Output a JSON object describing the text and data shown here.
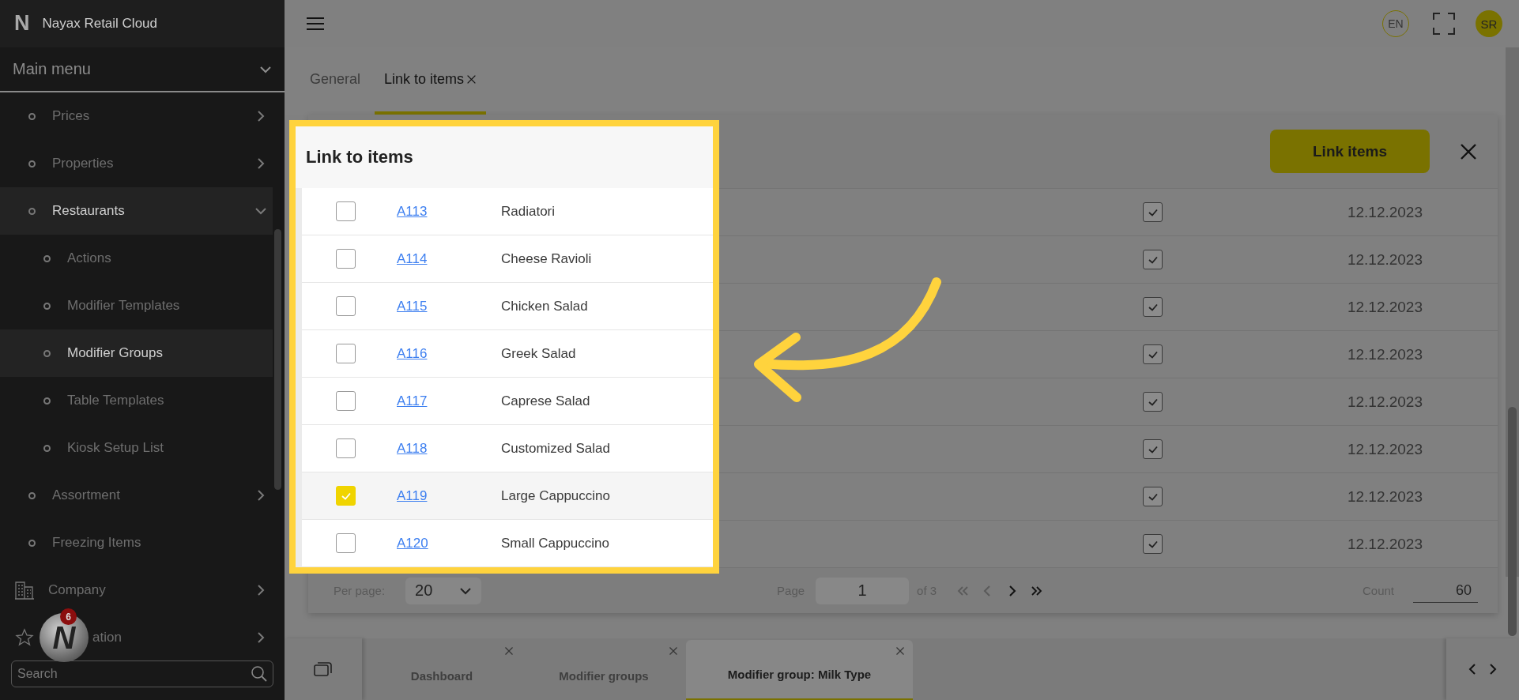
{
  "sidebar": {
    "brand": {
      "logo": "N",
      "name": "Nayax Retail Cloud"
    },
    "menu_title": "Main menu",
    "items": [
      {
        "label": "Prices",
        "kind": "bullet",
        "expanded": false,
        "selected": false
      },
      {
        "label": "Properties",
        "kind": "bullet",
        "expanded": false,
        "selected": false
      },
      {
        "label": "Restaurants",
        "kind": "bullet",
        "expanded": true,
        "selected": true,
        "children": [
          {
            "label": "Actions",
            "selected": false
          },
          {
            "label": "Modifier Templates",
            "selected": false
          },
          {
            "label": "Modifier Groups",
            "selected": true
          },
          {
            "label": "Table Templates",
            "selected": false
          },
          {
            "label": "Kiosk Setup List",
            "selected": false
          }
        ]
      },
      {
        "label": "Assortment",
        "kind": "bullet",
        "expanded": false,
        "selected": false
      },
      {
        "label": "Freezing Items",
        "kind": "bullet",
        "selected": false
      },
      {
        "label": "Company",
        "kind": "building",
        "expanded": false,
        "selected": false
      },
      {
        "label": "ation",
        "kind": "star",
        "expanded": false,
        "selected": false
      }
    ],
    "helper": {
      "logo": "N",
      "badge": "6"
    },
    "search": {
      "placeholder": "Search"
    }
  },
  "topbar": {
    "language": "EN",
    "user_initials": "SR"
  },
  "tabs": [
    {
      "label": "General",
      "selected": false,
      "closable": false
    },
    {
      "label": "Link to items",
      "selected": true,
      "closable": true
    }
  ],
  "card": {
    "button": "Link items",
    "rows": [
      {
        "checked": true,
        "date": "12.12.2023"
      },
      {
        "checked": true,
        "date": "12.12.2023"
      },
      {
        "checked": true,
        "date": "12.12.2023"
      },
      {
        "checked": true,
        "date": "12.12.2023"
      },
      {
        "checked": true,
        "date": "12.12.2023"
      },
      {
        "checked": true,
        "date": "12.12.2023"
      },
      {
        "checked": true,
        "date": "12.12.2023"
      },
      {
        "checked": true,
        "date": "12.12.2023"
      }
    ],
    "footer": {
      "per_page_label": "Per page:",
      "per_page": "20",
      "page_label": "Page",
      "page": "1",
      "page_total": "of 3",
      "count_label": "Count",
      "count": "60"
    }
  },
  "dialog": {
    "title": "Link to items",
    "rows": [
      {
        "code": "A113",
        "name": "Radiatori",
        "checked": false
      },
      {
        "code": "A114",
        "name": "Cheese Ravioli",
        "checked": false
      },
      {
        "code": "A115",
        "name": "Chicken Salad",
        "checked": false
      },
      {
        "code": "A116",
        "name": "Greek Salad",
        "checked": false
      },
      {
        "code": "A117",
        "name": "Caprese Salad",
        "checked": false
      },
      {
        "code": "A118",
        "name": "Customized Salad",
        "checked": false
      },
      {
        "code": "A119",
        "name": "Large Cappuccino",
        "checked": true
      },
      {
        "code": "A120",
        "name": "Small Cappuccino",
        "checked": false
      }
    ]
  },
  "bottom_tabs": [
    {
      "label": "Dashboard",
      "selected": false
    },
    {
      "label": "Modifier groups",
      "selected": false
    },
    {
      "label": "Modifier group: Milk Type",
      "selected": true
    }
  ]
}
